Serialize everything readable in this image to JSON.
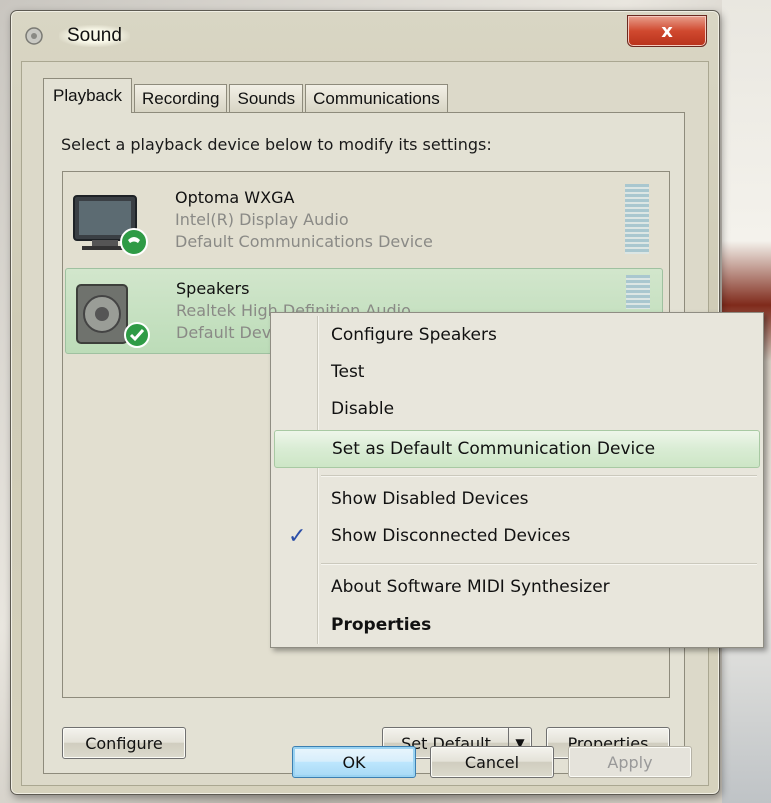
{
  "window": {
    "title": "Sound",
    "close_label": "x"
  },
  "tabs": [
    {
      "label": "Playback",
      "active": true
    },
    {
      "label": "Recording",
      "active": false
    },
    {
      "label": "Sounds",
      "active": false
    },
    {
      "label": "Communications",
      "active": false
    }
  ],
  "playback": {
    "instruction": "Select a playback device below to modify its settings:",
    "devices": [
      {
        "name": "Optoma WXGA",
        "driver": "Intel(R) Display Audio",
        "status": "Default Communications Device",
        "icon": "monitor-icon",
        "badge": "phone-badge-icon",
        "selected": false
      },
      {
        "name": "Speakers",
        "driver": "Realtek High Definition Audio",
        "status": "Default Device",
        "icon": "speaker-icon",
        "badge": "checkmark-badge-icon",
        "selected": true
      }
    ],
    "buttons": {
      "configure": "Configure",
      "set_default": "Set Default",
      "properties": "Properties"
    }
  },
  "context_menu": {
    "items": [
      {
        "label": "Configure Speakers"
      },
      {
        "label": "Test"
      },
      {
        "label": "Disable"
      },
      {
        "label": "Set as Default Communication Device",
        "highlighted": true
      },
      {
        "label": "Show Disabled Devices"
      },
      {
        "label": "Show Disconnected Devices",
        "checked": true
      },
      {
        "label": "About Software MIDI Synthesizer"
      },
      {
        "label": "Properties",
        "bold": true
      }
    ]
  },
  "dialog_buttons": {
    "ok": "OK",
    "cancel": "Cancel",
    "apply": "Apply"
  },
  "colors": {
    "selection": "#c8e2c2",
    "close_button": "#d0492f",
    "check": "#2b4ea8"
  }
}
